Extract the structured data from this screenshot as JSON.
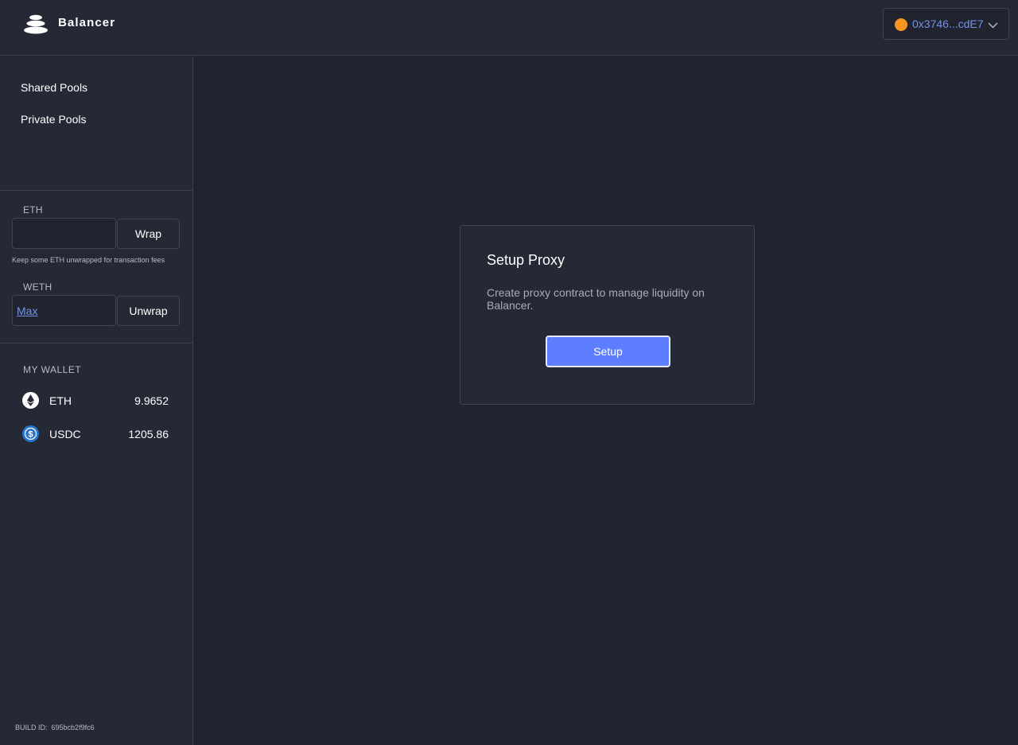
{
  "header": {
    "brand": "Balancer",
    "account_address": "0x3746...cdE7"
  },
  "sidebar": {
    "nav": [
      {
        "label": "Shared Pools"
      },
      {
        "label": "Private Pools"
      }
    ],
    "eth": {
      "label": "ETH",
      "input_value": "",
      "button": "Wrap",
      "hint": "Keep some ETH unwrapped for transaction fees"
    },
    "weth": {
      "label": "WETH",
      "max_link": "Max",
      "button": "Unwrap"
    },
    "wallet": {
      "title": "MY WALLET",
      "tokens": [
        {
          "symbol": "ETH",
          "balance": "9.9652",
          "icon": "ethereum-icon"
        },
        {
          "symbol": "USDC",
          "balance": "1205.86",
          "icon": "usdc-icon"
        }
      ]
    },
    "build": {
      "label": "BUILD ID:",
      "id": "695bcb2f9fc6"
    }
  },
  "modal": {
    "title": "Setup Proxy",
    "text": "Create proxy contract to manage liquidity on Balancer.",
    "button": "Setup"
  },
  "colors": {
    "background": "#21232e",
    "panel": "#252835",
    "accent": "#5c7eff",
    "link": "#7393e8",
    "account_dot": "#f49523"
  }
}
